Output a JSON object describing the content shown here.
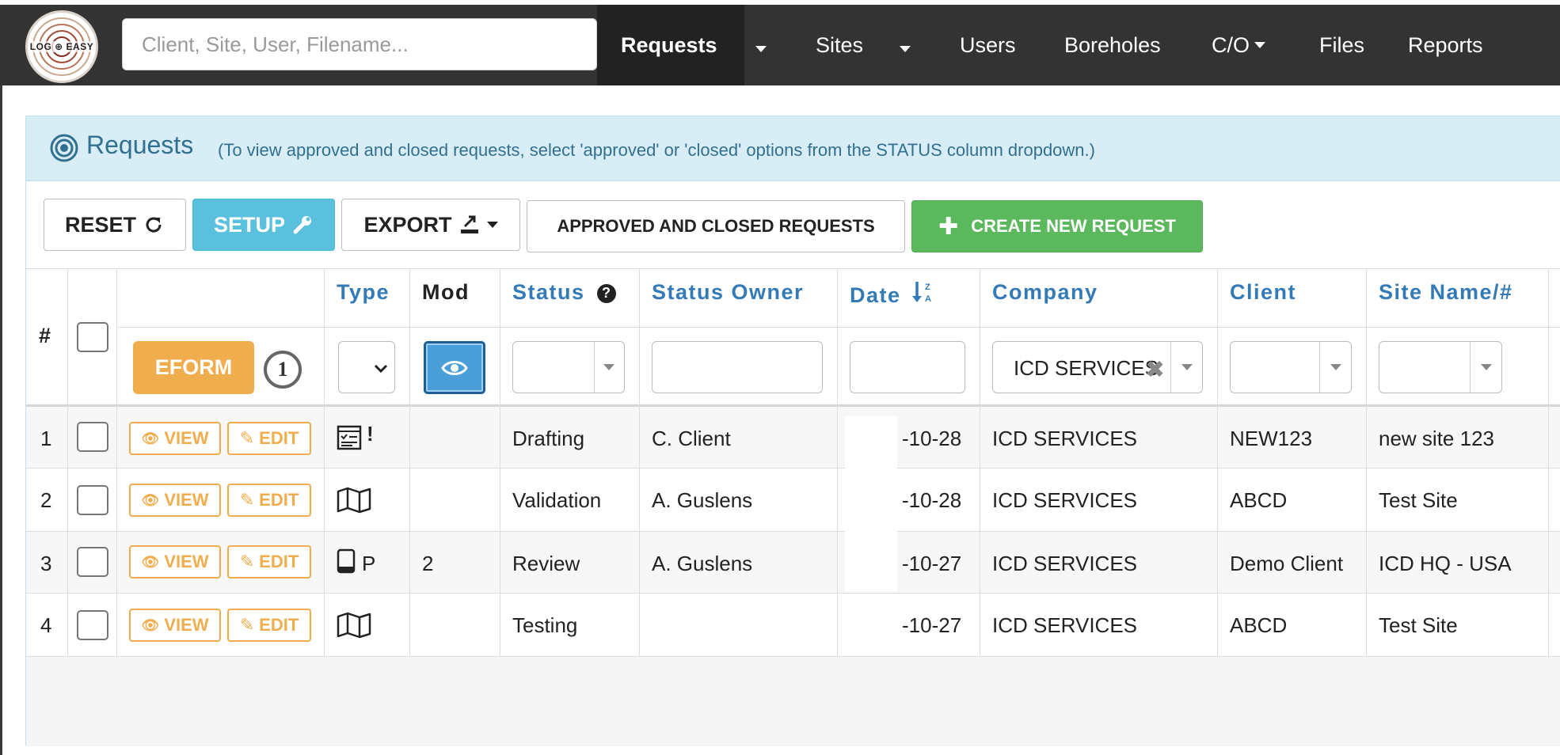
{
  "logo": {
    "text": "LOG ⊕ EASY"
  },
  "search": {
    "placeholder": "Client, Site, User, Filename..."
  },
  "nav": {
    "requests": "Requests",
    "sites": "Sites",
    "users": "Users",
    "boreholes": "Boreholes",
    "co": "C/O",
    "files": "Files",
    "reports": "Reports"
  },
  "panel": {
    "title": "Requests",
    "note": "(To view approved and closed requests, select 'approved' or 'closed' options from the STATUS column dropdown.)"
  },
  "toolbar": {
    "reset": "RESET",
    "setup": "SETUP",
    "export": "EXPORT",
    "approved_closed": "APPROVED AND CLOSED REQUESTS",
    "create": "CREATE NEW REQUEST"
  },
  "table": {
    "headers": {
      "num": "#",
      "type": "Type",
      "mod": "Mod",
      "status": "Status",
      "status_owner": "Status Owner",
      "date": "Date",
      "company": "Company",
      "client": "Client",
      "site": "Site Name/#"
    },
    "filters": {
      "eform": "EFORM",
      "eform_count": "1",
      "company_value": "ICD SERVICES"
    },
    "row_buttons": {
      "view": "VIEW",
      "edit": "EDIT"
    },
    "rows": [
      {
        "num": "1",
        "type_icon": "form-icon",
        "type_extra": "!",
        "mod": "",
        "status": "Drafting",
        "owner": "C. Client",
        "date": "-10-28",
        "company": "ICD SERVICES",
        "client": "NEW123",
        "site": "new site 123"
      },
      {
        "num": "2",
        "type_icon": "map-icon",
        "type_extra": "",
        "mod": "",
        "status": "Validation",
        "owner": "A. Guslens",
        "date": "-10-28",
        "company": "ICD SERVICES",
        "client": "ABCD",
        "site": "Test Site"
      },
      {
        "num": "3",
        "type_icon": "tablet-icon",
        "type_extra": "P",
        "mod": "2",
        "status": "Review",
        "owner": "A. Guslens",
        "date": "-10-27",
        "company": "ICD SERVICES",
        "client": "Demo Client",
        "site": "ICD HQ - USA"
      },
      {
        "num": "4",
        "type_icon": "map-icon",
        "type_extra": "",
        "mod": "",
        "status": "Testing",
        "owner": "",
        "date": "-10-27",
        "company": "ICD SERVICES",
        "client": "ABCD",
        "site": "Test Site"
      }
    ]
  },
  "colors": {
    "navbar": "#333333",
    "heading_bg": "#d9edf7",
    "heading_text": "#31708f",
    "link_blue": "#337ab7",
    "warning": "#f0ad4e",
    "info": "#5bc0de",
    "success": "#5cb85c"
  }
}
